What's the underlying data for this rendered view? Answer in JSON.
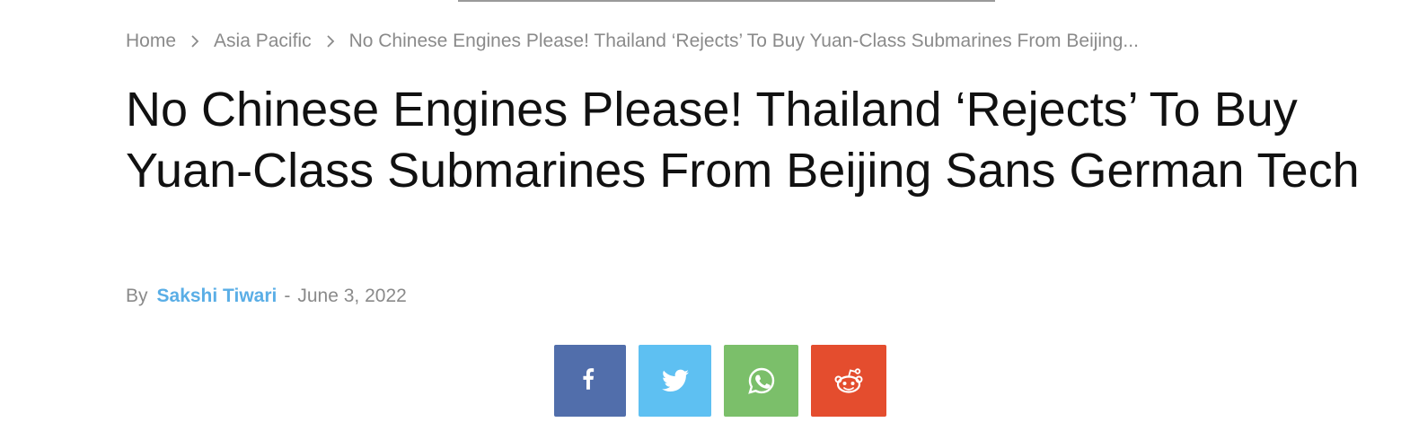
{
  "breadcrumb": {
    "home": "Home",
    "category": "Asia Pacific",
    "current": "No Chinese Engines Please! Thailand ‘Rejects’ To Buy Yuan-Class Submarines From Beijing..."
  },
  "article": {
    "title": "No Chinese Engines Please! Thailand ‘Rejects’ To Buy Yuan-Class Submarines From Beijing Sans German Tech",
    "by_label": "By",
    "author": "Sakshi Tiwari",
    "separator": "-",
    "date": "June 3, 2022"
  },
  "share": {
    "buttons": [
      {
        "network": "facebook",
        "icon": "facebook-icon",
        "color": "#516eab"
      },
      {
        "network": "twitter",
        "icon": "twitter-icon",
        "color": "#5ec0f2"
      },
      {
        "network": "whatsapp",
        "icon": "whatsapp-icon",
        "color": "#7bbf6a"
      },
      {
        "network": "reddit",
        "icon": "reddit-icon",
        "color": "#e44d2e"
      }
    ]
  },
  "colors": {
    "author_link": "#5aaee6",
    "muted_text": "#8a8a8a",
    "title_text": "#111111"
  }
}
